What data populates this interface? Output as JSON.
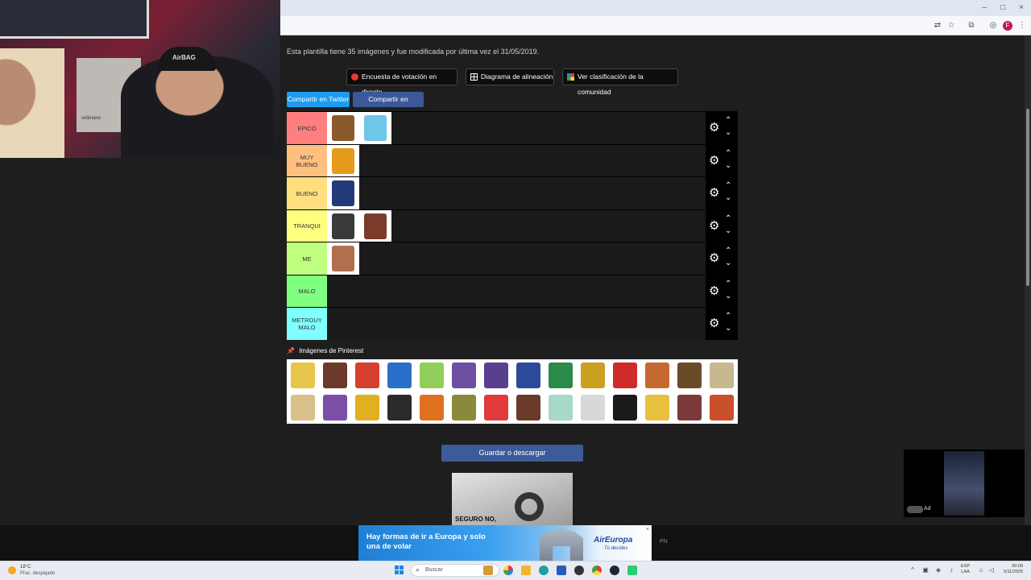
{
  "webcam": {
    "shelf_text": "solimano",
    "cap_text": "AirBAG"
  },
  "browser": {
    "colors": {
      "titlebar": "#dfe6f1",
      "toolbar": "#f6f8fb",
      "profile": "#c2185b"
    },
    "profile_initial": "F"
  },
  "page": {
    "info": "Esta plantilla tiene 35 imágenes y fue modificada por última vez el 31/05/2019.",
    "buttons": {
      "poll": "Encuesta de votación en directo",
      "alignment": "Diagrama de alineación",
      "community": "Ver clasificación de la comunidad"
    },
    "share": {
      "twitter": "Compartir en Twitter",
      "facebook": "Compartir en Facebook"
    },
    "tiers": [
      {
        "label": "EPICO",
        "color": "#ff7f7f",
        "items": [
          "#8b5a2b",
          "#6ec6e8"
        ]
      },
      {
        "label": "MUY BUENO",
        "color": "#ffbf7f",
        "items": [
          "#e69a1a"
        ]
      },
      {
        "label": "BUENO",
        "color": "#ffdf7f",
        "items": [
          "#233a7a"
        ]
      },
      {
        "label": "TRANQUI",
        "color": "#ffff7f",
        "items": [
          "#3a3a3a",
          "#7a3b2a"
        ]
      },
      {
        "label": "ME",
        "color": "#bfff7f",
        "items": [
          "#b07050"
        ]
      },
      {
        "label": "MALO",
        "color": "#7fff7f",
        "items": []
      },
      {
        "label": "METROUY MALO",
        "color": "#7fffff",
        "items": []
      }
    ],
    "pinterest_label": "Imágenes de Pinterest",
    "pinterest_thumbs": [
      "#e8c64a",
      "#6b3a2a",
      "#d6402e",
      "#2a6fc9",
      "#8fcf5a",
      "#6e4fa0",
      "#5a3f8f",
      "#2c4a9a",
      "#2a8a4a",
      "#c9a020",
      "#d02a2a",
      "#c46a30",
      "#6b4a2a",
      "#c8b890",
      "#d8c08a",
      "#7a4fa8",
      "#e0b020",
      "#2a2a2a",
      "#e07020",
      "#8a8a3a",
      "#e03a3a",
      "#6a3a2a",
      "#a8d8c8",
      "#d8d8d8",
      "#1a1a1a",
      "#e8c040",
      "#7a3a3a",
      "#c8502a"
    ],
    "save_button": "Guardar o descargar",
    "ad_text": "SEGURO NO,"
  },
  "mini_video": {
    "ad_label": "Ad"
  },
  "banner": {
    "headline": "Hay formas de ir a Europa y solo una de volar",
    "logo": "AirEuropa",
    "sub": "Tú decides",
    "close": "×",
    "side_text": "PN"
  },
  "taskbar": {
    "weather_temp": "18°C",
    "weather_desc": "Prac. despejado",
    "search_placeholder": "Buscar",
    "lang": "ESP\nLAA",
    "time": "00:09",
    "date": "5/11/2025"
  }
}
